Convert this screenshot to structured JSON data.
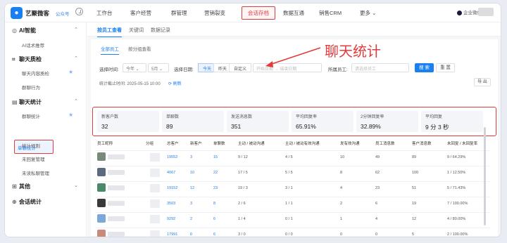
{
  "header": {
    "app_name": "艺聚微客",
    "pub_badge": "公众号",
    "nav": [
      "工作台",
      "客户经营",
      "群管理",
      "营销裂变",
      "会话存档",
      "数据互通",
      "销售CRM",
      "更多"
    ],
    "active_nav": "会话存档",
    "user_badge": "企业微信"
  },
  "sidebar": {
    "groups": [
      {
        "label": "AI智能",
        "items": [
          "AI话术推荐"
        ]
      },
      {
        "label": "聊天质检",
        "items": [
          "聊天内容质检",
          "群聊行为"
        ]
      },
      {
        "label": "聊天统计",
        "items": [
          "群聊统计",
          "单聊统计",
          "统计规则",
          "未回复管理",
          "未读私聊管理"
        ]
      },
      {
        "label": "其他"
      },
      {
        "label": "会话统计"
      }
    ]
  },
  "subtabs": [
    "按员工查看",
    "关键词",
    "数据记录"
  ],
  "card": {
    "inner_tabs": [
      "全部员工",
      "按分组查看"
    ],
    "filters": {
      "time_label": "选择时间:",
      "year": "今年",
      "month": "5月",
      "date_label": "选择日期:",
      "date_options": [
        "今天",
        "昨天",
        "自定义"
      ],
      "start_placeholder": "开始日期",
      "end_placeholder": "结束日期",
      "staff_label": "所属员工:",
      "staff_placeholder": "请选择员工",
      "search": "搜 索",
      "reset": "重 置"
    },
    "stat_time": "统计截止时间: 2025-05-15 10:00",
    "refresh": "⟳ 刷新",
    "export": "导 出",
    "stats": [
      {
        "t": "新客户数",
        "v": "32"
      },
      {
        "t": "单聊数",
        "v": "89"
      },
      {
        "t": "发送消息数",
        "v": "351"
      },
      {
        "t": "平均回复率",
        "v": "65.91%"
      },
      {
        "t": "2分钟回复率",
        "v": "32.89%"
      },
      {
        "t": "平均回复",
        "v": "9 分 3 秒"
      }
    ],
    "columns": [
      "员工昵称",
      "分组",
      "总客户",
      "新客户",
      "单聊数",
      "主动 / 被动沟通",
      "主动 / 被动有效沟通",
      "发有效沟通",
      "员工消息数",
      "客户消息数",
      "未回复 / 未回复率"
    ],
    "rows": [
      [
        "",
        "",
        "19552",
        "3",
        "15",
        "9 / 12",
        "4 / 5",
        "10",
        "49",
        "89",
        "9 / 64.29%"
      ],
      [
        "",
        "",
        "4067",
        "10",
        "22",
        "17 / 5",
        "5 / 5",
        "8",
        "62",
        "100",
        "1 / 12.50%"
      ],
      [
        "",
        "",
        "19152",
        "12",
        "23",
        "19 / 3",
        "3 / 1",
        "4",
        "23",
        "51",
        "5 / 71.43%"
      ],
      [
        "",
        "",
        "3503",
        "3",
        "8",
        "2 / 6",
        "1 / 1",
        "2",
        "6",
        "19",
        "7 / 100.00%"
      ],
      [
        "",
        "",
        "9292",
        "2",
        "6",
        "1 / 4",
        "0 / 1",
        "1",
        "4",
        "12",
        "4 / 80.00%"
      ],
      [
        "",
        "",
        "17991",
        "0",
        "6",
        "3 / 0",
        "0 / 0",
        "0",
        "0",
        "5",
        "2 / 100.00%"
      ]
    ]
  },
  "annotation": "聊天统计"
}
